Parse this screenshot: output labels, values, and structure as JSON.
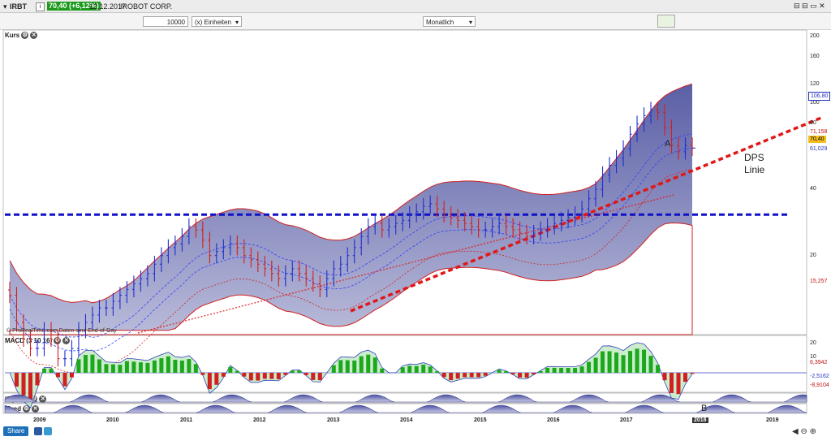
{
  "header": {
    "symbol": "IRBT",
    "price_change": "70,40 (+6,12%)",
    "date": "12.12.2017",
    "company": "IROBOT CORP.",
    "quantity_value": "10000",
    "units_label": "(x) Einheiten",
    "period_label": "Monatlich",
    "share_label": "Share"
  },
  "colors": {
    "up": "#1f2fd0",
    "down": "#d02020",
    "fill": "#6a6fae",
    "accent": "#1c9a1c"
  },
  "panels": {
    "price_title": "Kurs",
    "macd_title": "MACD (3 10 16)",
    "isgreen_title": "ISgreen",
    "isred_title": "ISred",
    "copyright": "© ProRealTime.com Daten sind End-of-Day"
  },
  "annotations": {
    "a": "A",
    "b": "B",
    "dps1": "DPS",
    "dps2": "Linie"
  },
  "chart_data": {
    "type": "candlestick",
    "title": "IRBT Monatlich",
    "y_scale": "log",
    "y_ticks": [
      "200",
      "160",
      "120",
      "100",
      "80",
      "40",
      "20"
    ],
    "y_price_labels": [
      "106,80",
      "71,158",
      "70,40",
      "61,029",
      "15,257"
    ],
    "x_ticks": [
      "2009",
      "2010",
      "2011",
      "2012",
      "2013",
      "2014",
      "2015",
      "2016",
      "2017",
      "2018",
      "2019"
    ],
    "last_close": 70.4,
    "upper_band": 106.8,
    "lower_band": 15.257,
    "support_level": 38,
    "macd_labels": [
      "20",
      "10",
      "6,3942",
      "-2,5162",
      "-8,9104"
    ],
    "monthly_close": [
      18,
      14,
      12,
      11,
      11,
      13,
      12,
      10,
      10,
      11,
      13,
      14,
      15,
      16,
      16,
      17,
      18,
      19,
      20,
      21,
      22,
      24,
      26,
      28,
      29,
      31,
      34,
      33,
      30,
      26,
      27,
      28,
      29,
      28,
      26,
      25,
      24,
      23,
      22,
      21,
      22,
      23,
      22,
      21,
      20,
      19,
      21,
      23,
      24,
      26,
      28,
      31,
      34,
      35,
      33,
      34,
      35,
      36,
      38,
      39,
      41,
      42,
      40,
      38,
      37,
      36,
      35,
      34,
      33,
      33,
      34,
      35,
      34,
      33,
      32,
      31,
      32,
      33,
      34,
      35,
      36,
      37,
      38,
      40,
      44,
      48,
      55,
      60,
      64,
      70,
      80,
      88,
      95,
      100,
      98,
      85,
      72,
      68,
      72,
      70.4
    ]
  }
}
